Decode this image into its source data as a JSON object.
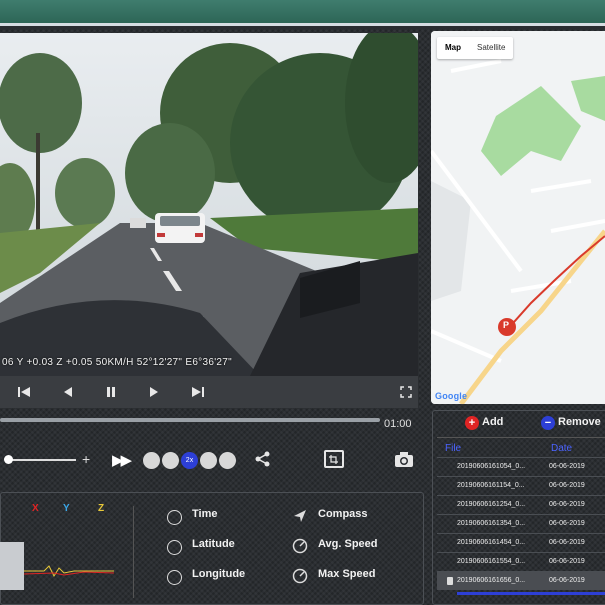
{
  "video": {
    "overlay": "06 Y +0.03 Z +0.05 50KM/H 52°12'27\" E6°36'27\"",
    "controls": {
      "prev_label": "◀◀",
      "rewind_label": "◀",
      "pause_label": "❚❚",
      "play_label": "▶",
      "next_label": "▶▶",
      "fullscreen_label": "⤢"
    }
  },
  "map": {
    "tabs": [
      "Map",
      "Satellite"
    ],
    "active_tab": "Map",
    "marker_label": "P",
    "logo": "Google",
    "route_color": "#d93a2b"
  },
  "timeline": {
    "progress": 0.0,
    "time": "01:00"
  },
  "playback": {
    "volume_plus": "+",
    "speed_dots": [
      "",
      "",
      "2x",
      "",
      ""
    ],
    "active_speed_index": 2,
    "ff_icon": "▶▶"
  },
  "sensors": {
    "axes": [
      {
        "label": "X",
        "color": "#e02424"
      },
      {
        "label": "Y",
        "color": "#3aa7e8"
      },
      {
        "label": "Z",
        "color": "#e8c93a"
      }
    ],
    "info": [
      {
        "title": "Time",
        "icon": "clock-icon"
      },
      {
        "title": "Latitude",
        "icon": "globe-icon"
      },
      {
        "title": "Longitude",
        "icon": "globe-icon"
      },
      {
        "title": "Compass",
        "icon": "compass-icon"
      },
      {
        "title": "Avg. Speed",
        "icon": "speedometer-icon"
      },
      {
        "title": "Max Speed",
        "icon": "speedometer-icon"
      }
    ]
  },
  "files": {
    "add_label": "Add",
    "remove_label": "Remove",
    "columns": [
      "File",
      "Date"
    ],
    "rows": [
      {
        "name": "20190606161054_0...",
        "date": "06-06-2019"
      },
      {
        "name": "20190606161154_0...",
        "date": "06-06-2019"
      },
      {
        "name": "20190606161254_0...",
        "date": "06-06-2019"
      },
      {
        "name": "20190606161354_0...",
        "date": "06-06-2019"
      },
      {
        "name": "20190606161454_0...",
        "date": "06-06-2019"
      },
      {
        "name": "20190606161554_0...",
        "date": "06-06-2019"
      },
      {
        "name": "20190606161656_0...",
        "date": "06-06-2019"
      }
    ],
    "selected_index": 6
  }
}
